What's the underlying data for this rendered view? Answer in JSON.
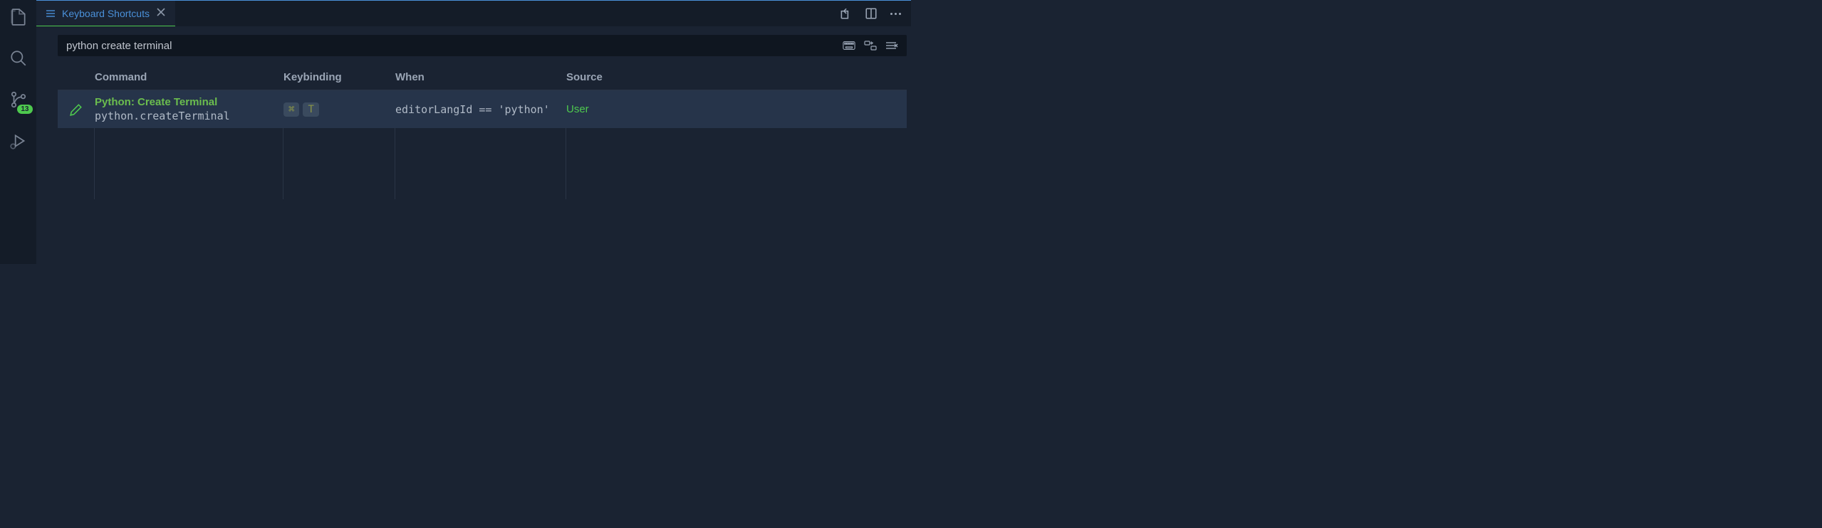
{
  "activityBar": {
    "badge": "13"
  },
  "tab": {
    "title": "Keyboard Shortcuts"
  },
  "search": {
    "value": "python create terminal"
  },
  "columns": {
    "command": "Command",
    "keybinding": "Keybinding",
    "when": "When",
    "source": "Source"
  },
  "rows": [
    {
      "commandTitle": "Python: Create Terminal",
      "commandId": "python.createTerminal",
      "keys": [
        "⌘",
        "T"
      ],
      "when": "editorLangId == 'python'",
      "source": "User"
    }
  ]
}
